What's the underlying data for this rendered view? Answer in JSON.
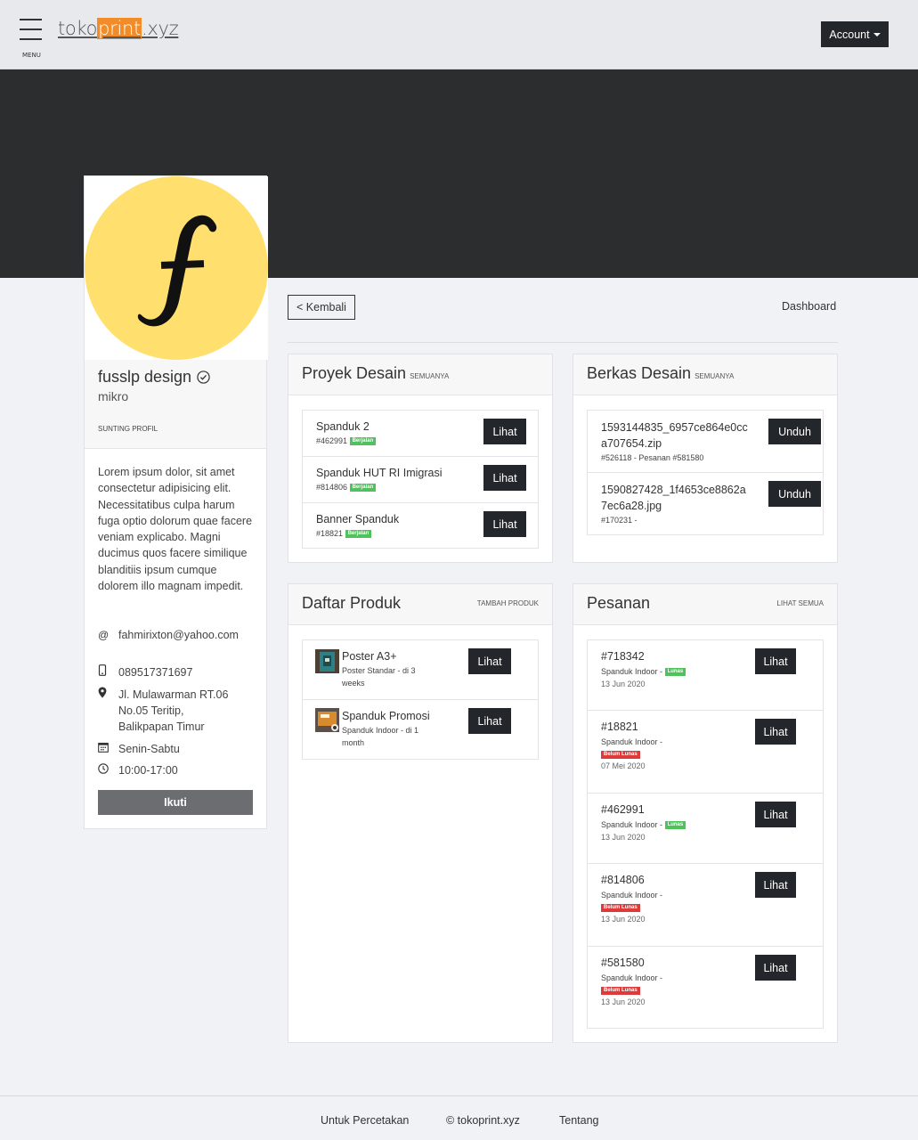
{
  "header": {
    "menu_label": "MENU",
    "logo_pre": "toko",
    "logo_hl": "print",
    "logo_post": ".xyz",
    "account_label": "Account"
  },
  "profile": {
    "name": "fusslp design",
    "tier": "mikro",
    "edit_label": "SUNTING PROFIL",
    "bio": "Lorem ipsum dolor, sit amet consectetur adipisicing elit. Necessitatibus culpa harum fuga optio dolorum quae facere veniam explicabo. Magni ducimus quos facere similique blanditiis ipsum cumque dolorem illo magnam impedit.",
    "email": "fahmirixton@yahoo.com",
    "phone": "089517371697",
    "address": "Jl. Mulawarman RT.06 No.05 Teritip, Balikpapan Timur",
    "days": "Senin-Sabtu",
    "hours": "10:00-17:00",
    "follow_label": "Ikuti"
  },
  "nav": {
    "back_label": "< Kembali",
    "dashboard_label": "Dashboard"
  },
  "projects": {
    "title": "Proyek Desain",
    "link": "SEMUANYA",
    "items": [
      {
        "title": "Spanduk 2",
        "id": "#462991",
        "status": "Berjalan",
        "button": "Lihat"
      },
      {
        "title": "Spanduk HUT RI Imigrasi",
        "id": "#814806",
        "status": "Berjalan",
        "button": "Lihat"
      },
      {
        "title": "Banner Spanduk",
        "id": "#18821",
        "status": "Berjalan",
        "button": "Lihat"
      }
    ]
  },
  "files": {
    "title": "Berkas Desain",
    "link": "SEMUANYA",
    "items": [
      {
        "name_l1": "1593144835_6957ce864e0cc",
        "name_l2": "a707654.zip",
        "meta": "#526118 - Pesanan #581580",
        "button": "Unduh"
      },
      {
        "name_l1": "1590827428_1f4653ce8862a",
        "name_l2": "7ec6a28.jpg",
        "meta": "#170231 -",
        "button": "Unduh"
      }
    ]
  },
  "products": {
    "title": "Daftar Produk",
    "link": "TAMBAH PRODUK",
    "items": [
      {
        "title": "Poster A3+",
        "sub_l1": "Poster Standar - di 3",
        "sub_l2": "weeks",
        "button": "Lihat"
      },
      {
        "title": "Spanduk Promosi",
        "sub_l1": "Spanduk Indoor - di 1",
        "sub_l2": "month",
        "button": "Lihat"
      }
    ]
  },
  "orders": {
    "title": "Pesanan",
    "link": "LIHAT SEMUA",
    "items": [
      {
        "id": "#718342",
        "product": "Spanduk Indoor -",
        "status": "Lunas",
        "date": "13 Jun 2020",
        "button": "Lihat"
      },
      {
        "id": "#18821",
        "product": "Spanduk Indoor -",
        "status": "Belum Lunas",
        "date": "07 Mei 2020",
        "button": "Lihat"
      },
      {
        "id": "#462991",
        "product": "Spanduk Indoor -",
        "status": "Lunas",
        "date": "13 Jun 2020",
        "button": "Lihat"
      },
      {
        "id": "#814806",
        "product": "Spanduk Indoor -",
        "status": "Belum Lunas",
        "date": "13 Jun 2020",
        "button": "Lihat"
      },
      {
        "id": "#581580",
        "product": "Spanduk Indoor -",
        "status": "Belum Lunas",
        "date": "13 Jun 2020",
        "button": "Lihat"
      }
    ]
  },
  "footer": {
    "link1": "Untuk Percetakan",
    "link2": "© tokoprint.xyz",
    "link3": "Tentang"
  },
  "colors": {
    "brand_accent": "#f28c28",
    "dark": "#23272b",
    "hero": "#2c2d2e",
    "status_green": "#4fc25b",
    "status_red": "#de3a3a",
    "avatar_bg": "#ffdf6e"
  }
}
